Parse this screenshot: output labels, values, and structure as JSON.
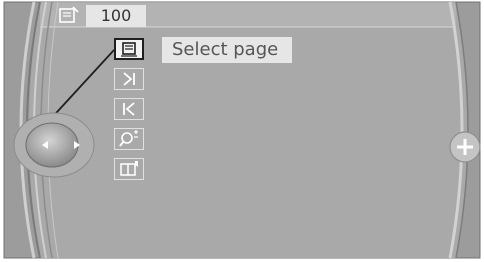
{
  "header": {
    "page_icon": "book-page-icon",
    "page_number": "100"
  },
  "menu": {
    "items": [
      {
        "icon": "select-page-icon",
        "selected": true
      },
      {
        "icon": "skip-forward-icon",
        "selected": false
      },
      {
        "icon": "skip-back-icon",
        "selected": false
      },
      {
        "icon": "zoom-icon",
        "selected": false
      },
      {
        "icon": "book-marker-icon",
        "selected": false
      }
    ]
  },
  "tooltip": {
    "label": "Select page"
  },
  "controller": {
    "left_icon": "controller-left-arrow-icon",
    "right_icon": "controller-right-arrow-icon"
  },
  "side_button": {
    "icon": "plus-icon"
  },
  "colors": {
    "screen": "#a9a9a9",
    "panel_highlight": "#e6e6e6",
    "outline": "#1f1f1f"
  }
}
